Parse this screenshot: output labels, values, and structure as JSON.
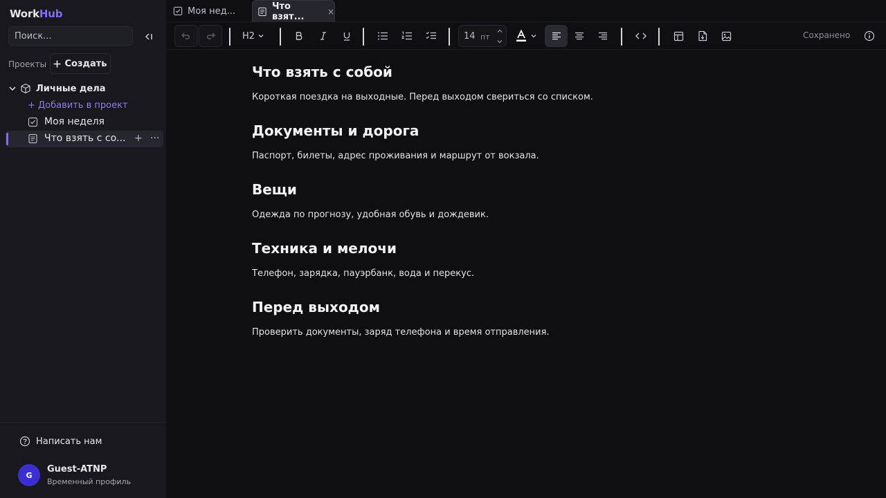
{
  "app": {
    "logo_main": "Work",
    "logo_accent": "Hub"
  },
  "sidebar": {
    "search_placeholder": "Поиск...",
    "projects_label": "Проекты",
    "create_label": "Создать",
    "project_name": "Личные дела",
    "add_to_project": "+ Добавить в проект",
    "items": [
      {
        "label": "Моя неделя",
        "icon": "checkbox-icon"
      },
      {
        "label": "Что взять с со...",
        "icon": "document-icon",
        "active": true
      }
    ],
    "help_label": "Написать нам",
    "user": {
      "initial": "G",
      "name": "Guest-ATNP",
      "subtitle": "Временный профиль"
    }
  },
  "tabs": [
    {
      "label": "Моя нед...",
      "icon": "checkbox-icon",
      "active": false
    },
    {
      "label": "Что взят...",
      "icon": "document-icon",
      "active": true,
      "close": "×"
    }
  ],
  "toolbar": {
    "heading_level": "H2",
    "font_size": "14",
    "font_unit": "пт",
    "saved_status": "Сохранено",
    "text_color": "#ffffff"
  },
  "document": {
    "sections": [
      {
        "heading": "Что взять с собой",
        "text": "Короткая поездка на выходные. Перед выходом свериться со списком."
      },
      {
        "heading": "Документы и дорога",
        "text": "Паспорт, билеты, адрес проживания и маршрут от вокзала."
      },
      {
        "heading": "Вещи",
        "text": "Одежда по прогнозу, удобная обувь и дождевик."
      },
      {
        "heading": "Техника и мелочи",
        "text": "Телефон, зарядка, пауэрбанк, вода и перекус."
      },
      {
        "heading": "Перед выходом",
        "text": "Проверить документы, заряд телефона и время отправления."
      }
    ]
  },
  "colors": {
    "accent": "#7c6ff0",
    "avatar": "#3b2fd0",
    "background": "#0f0f13",
    "sidebar": "#18181e"
  }
}
